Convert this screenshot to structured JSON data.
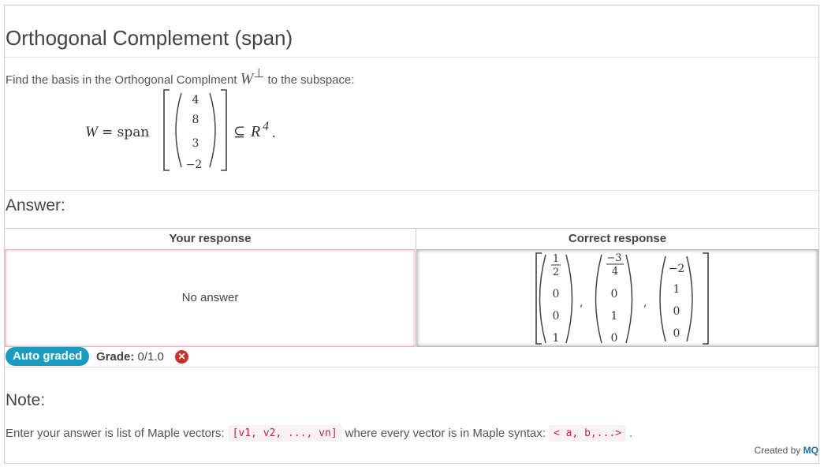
{
  "question": {
    "title": "Orthogonal Complement (span)",
    "description": "Find the basis in the Orthogonal Complment",
    "description_symbol": "W",
    "description_superscript": "⊥",
    "description_tail": "to the subspace:",
    "equation": {
      "lhs": "W",
      "equals_span": "= span",
      "vector": [
        "4",
        "8",
        "3",
        "−2"
      ],
      "subset": "⊆",
      "space": "R",
      "space_exponent": "4",
      "period": "."
    }
  },
  "answer_label": "Answer:",
  "table": {
    "your_response_header": "Your response",
    "correct_response_header": "Correct response",
    "your_response_value": "No answer",
    "correct_vectors": [
      [
        "1/2",
        "0",
        "0",
        "1"
      ],
      [
        "−3/4",
        "0",
        "1",
        "0"
      ],
      [
        "−2",
        "1",
        "0",
        "0"
      ]
    ]
  },
  "grading": {
    "badge": "Auto graded",
    "grade_label": "Grade:",
    "grade_value": "0/1.0",
    "status_icon": "x-circle-icon",
    "status_color": "#c9302c"
  },
  "note": {
    "label": "Note:",
    "text_start": "Enter your answer is list of Maple vectors:",
    "code_1": "[v1, v2, ..., vn]",
    "text_middle": "where every vector is in Maple syntax:",
    "code_2": "< a, b,...>",
    "text_end": "."
  },
  "credit": {
    "prefix": "Created by",
    "brand": "MQ"
  },
  "colors": {
    "accent": "#1a9bc1",
    "error": "#c9302c",
    "code": "#c7254e"
  }
}
